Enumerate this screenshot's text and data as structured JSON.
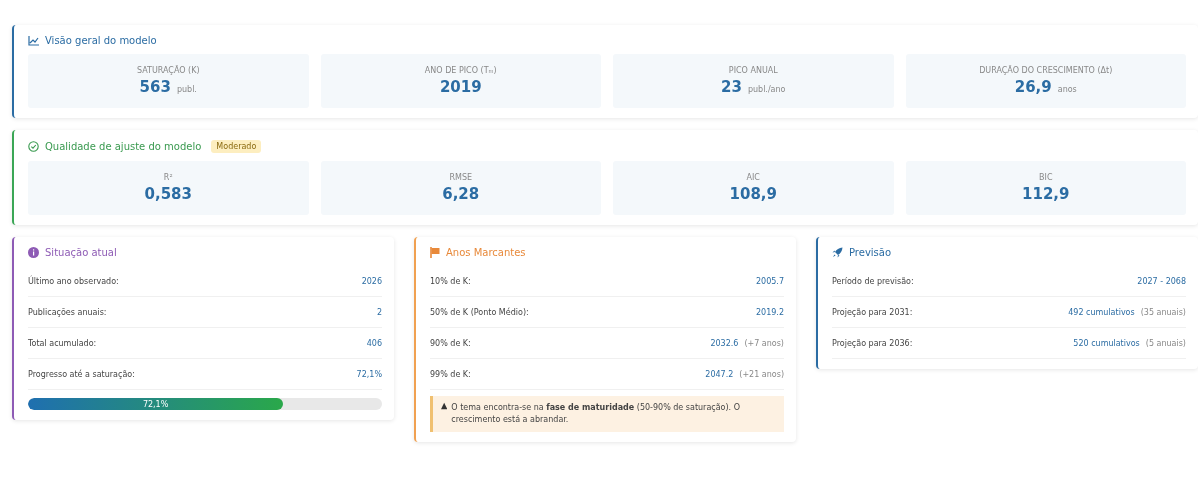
{
  "overview": {
    "title": "Visão geral do modelo",
    "metrics": [
      {
        "label": "SATURAÇÃO (K)",
        "value": "563",
        "unit": "publ."
      },
      {
        "label": "ANO DE PICO (Tₘ)",
        "value": "2019"
      },
      {
        "label": "PICO ANUAL",
        "value": "23",
        "unit": "publ./ano"
      },
      {
        "label": "DURAÇÃO DO CRESCIMENTO (Δt)",
        "value": "26,9",
        "unit": "anos"
      }
    ]
  },
  "fit": {
    "title": "Qualidade de ajuste do modelo",
    "badge": "Moderado",
    "metrics": [
      {
        "label": "R²",
        "value": "0,583"
      },
      {
        "label": "RMSE",
        "value": "6,28"
      },
      {
        "label": "AIC",
        "value": "108,9"
      },
      {
        "label": "BIC",
        "value": "112,9"
      }
    ]
  },
  "current": {
    "title": "Situação atual",
    "rows": [
      {
        "label": "Último ano observado:",
        "value": "2026"
      },
      {
        "label": "Publicações anuais:",
        "value": "2"
      },
      {
        "label": "Total acumulado:",
        "value": "406"
      },
      {
        "label": "Progresso até a saturação:",
        "value": "72,1%"
      }
    ],
    "progress": {
      "level": 0.721,
      "text": "72,1%"
    }
  },
  "milestones": {
    "title": "Anos Marcantes",
    "rows": [
      {
        "label": "10% de K:",
        "value": "2005.7"
      },
      {
        "label": "50% de K (Ponto Médio):",
        "value": "2019.2"
      },
      {
        "label": "90% de K:",
        "value": "2032.6",
        "note": "(+7 anos)"
      },
      {
        "label": "99% de K:",
        "value": "2047.2",
        "note": "(+21 anos)"
      }
    ],
    "warning": "O tema encontra-se na **fase de maturidade** (50-90% de saturação). O crescimento está a abrandar."
  },
  "forecast": {
    "title": "Previsão",
    "rows": [
      {
        "label": "Período de previsão:",
        "value": "2027 - 2068"
      },
      {
        "label": "Projeção para 2031:",
        "value": "492 cumulativos",
        "note": "(35 anuais)"
      },
      {
        "label": "Projeção para 2036:",
        "value": "520 cumulativos",
        "note": "(5 anuais)"
      }
    ]
  }
}
